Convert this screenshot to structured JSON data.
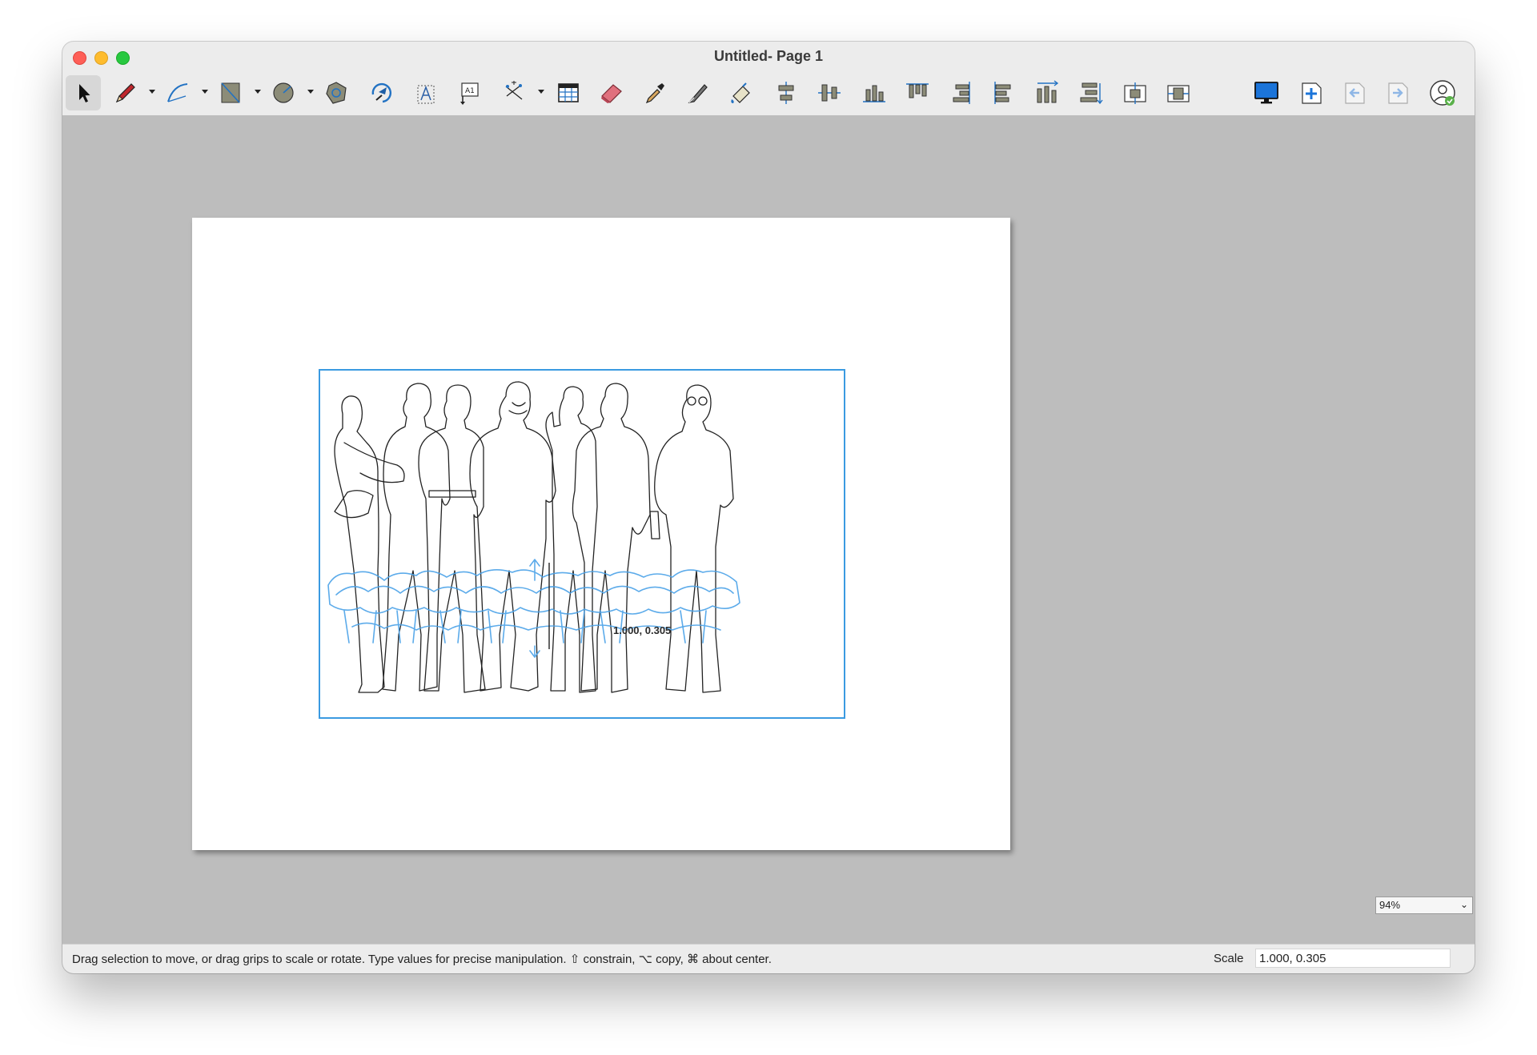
{
  "window": {
    "title": "Untitled- Page 1"
  },
  "toolbar": {
    "tools": [
      {
        "name": "select-tool",
        "icon": "arrow-pointer-icon"
      },
      {
        "name": "pencil-tool",
        "icon": "pencil-icon"
      },
      {
        "name": "curve-tool",
        "icon": "curve-icon"
      },
      {
        "name": "rectangle-tool",
        "icon": "rectangle-icon"
      },
      {
        "name": "circle-tool",
        "icon": "circle-icon"
      },
      {
        "name": "polygon-tool",
        "icon": "polygon-icon"
      },
      {
        "name": "rotate-tool",
        "icon": "rotate-icon"
      },
      {
        "name": "text-tool",
        "icon": "text-a-icon"
      },
      {
        "name": "callout-tool",
        "icon": "callout-a1-icon"
      },
      {
        "name": "dimension-tool",
        "icon": "dimension-icon"
      },
      {
        "name": "table-tool",
        "icon": "table-icon"
      },
      {
        "name": "eraser-tool",
        "icon": "eraser-icon"
      },
      {
        "name": "eyedropper-tool",
        "icon": "eyedropper-icon"
      },
      {
        "name": "knife-tool",
        "icon": "knife-icon"
      },
      {
        "name": "fill-tool",
        "icon": "paint-fill-icon"
      }
    ]
  },
  "canvas": {
    "scale_readout": "1.000, 0.305"
  },
  "status": {
    "hint": "Drag selection to move, or drag grips to scale or rotate. Type values for precise manipulation. ⇧ constrain, ⌥ copy, ⌘ about center.",
    "scale_label": "Scale",
    "scale_value": "1.000, 0.305"
  },
  "zoom": {
    "value": "94%"
  },
  "colors": {
    "selection": "#3b9ae1",
    "canvas_bg": "#bdbdbd"
  }
}
